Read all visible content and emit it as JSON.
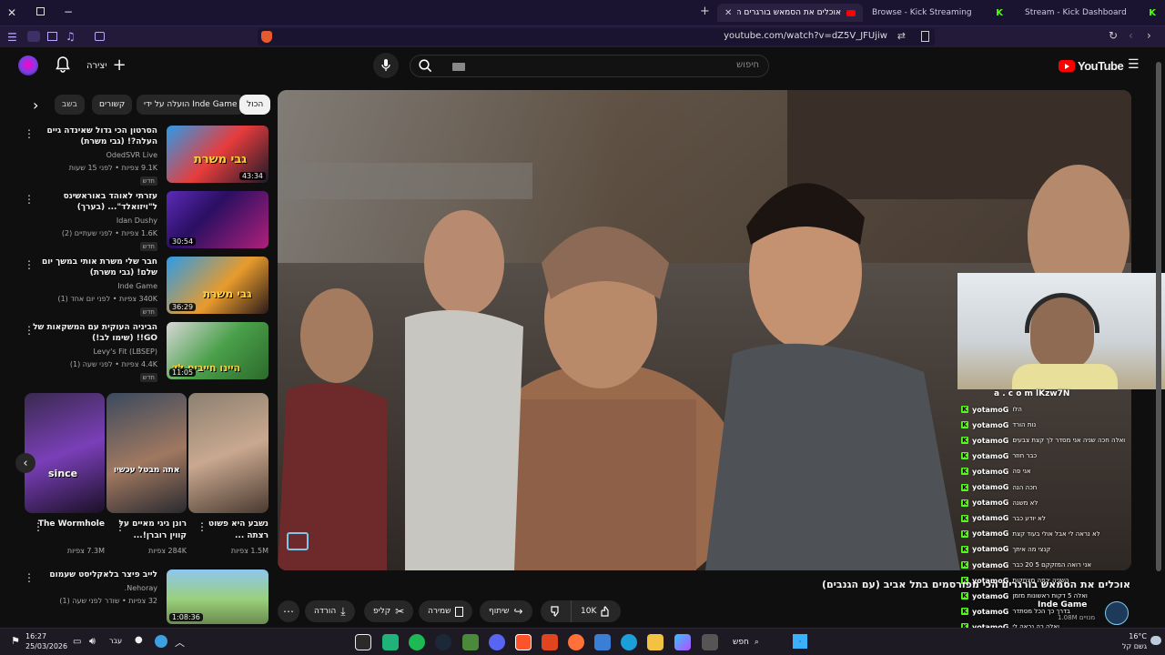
{
  "browser": {
    "tabs": [
      {
        "label": "אוכלים את הסמאש בורגרים ה",
        "active": true
      },
      {
        "label": "Browse - Kick Streaming",
        "active": false
      },
      {
        "label": "Stream - Kick Dashboard",
        "active": false
      }
    ],
    "address": "youtube.com/watch?v=dZ5V_JFUjiw"
  },
  "youtube": {
    "logo_text": "YouTube",
    "search_placeholder": "חיפוש",
    "create_label": "יצירה"
  },
  "chips": [
    "הכול",
    "הועלה על ידי Inde Game",
    "קשורים",
    "בשב"
  ],
  "recommended": [
    {
      "title": "הסרטון הכי גדול שאינדה גיים העלה?! (גבי משרת)",
      "channel": "OdedSVR Live",
      "meta": "9.1K צפיות • לפני 15 שעות",
      "duration": "43:34",
      "badge": "חדש",
      "thumb_text": "גבי משרת"
    },
    {
      "title": "עזרתי לאוהד באוראשינס ל\"ויזואלד\"... (בערך)",
      "channel": "Idan Dushy",
      "meta": "1.6K צפיות • לפני שעתיים (2)",
      "duration": "30:54",
      "badge": "חדש",
      "thumb_text": ""
    },
    {
      "title": "חבר שלי משרת אותי במשך יום שלם! (גבי משרת)",
      "channel": "Inde Game",
      "meta": "340K צפיות • לפני יום אחד (1)",
      "duration": "36:29",
      "badge": "חדש",
      "thumb_text": "גבי משרת"
    },
    {
      "title": "הביניה העוקית עם המשקאות של GO!! (שימו לב!)",
      "channel": "Levy's Fit (LBSEP)",
      "meta": "4.4K צפיות • לפני שעה (1)",
      "duration": "11:05",
      "badge": "חדש",
      "thumb_text": "היינו חייבים לד"
    }
  ],
  "shorts": [
    {
      "title": "The Wormhole",
      "views": "7.3M צפיות",
      "thumb_text": "since"
    },
    {
      "title": "רונן גיגי מאיים על קווין רוברן!...",
      "views": "284K צפיות",
      "thumb_text": "אתה מבטל עכשיו"
    },
    {
      "title": "נשבע היא פשוט רצתה ...",
      "views": "1.5M צפיות",
      "thumb_text": ""
    }
  ],
  "bottom_video": {
    "title": "לייב פיצר בלאקליסט שעמום",
    "channel": "Nehoray.",
    "meta": "32 צפיות • שודר לפני שעה (1)",
    "duration": "1:08:36"
  },
  "video": {
    "title": "אוכלים את הסמאש בורגרים הכי מפורסמים בתל אביב (עם הגנבים)",
    "likes": "10K",
    "share_label": "שיתוף",
    "save_label": "שמירה",
    "clip_label": "קליפ",
    "download_label": "הורדה"
  },
  "overlay": {
    "link_text": "a . c o m lKzw7N",
    "channel_badge": "Inde Game",
    "subs": "1.08M מנויים"
  },
  "chat": [
    {
      "user": "yotamoG",
      "text": "הלו"
    },
    {
      "user": "yotamoG",
      "text": "נות הורד"
    },
    {
      "user": "yotamoG",
      "text": "ואלה חכה שניה אני מסדר לך קצת צבעים"
    },
    {
      "user": "yotamoG",
      "text": "כבר חוזר"
    },
    {
      "user": "yotamoG",
      "text": "אני פה"
    },
    {
      "user": "yotamoG",
      "text": "חכה הנה"
    },
    {
      "user": "yotamoG",
      "text": "לא משנה"
    },
    {
      "user": "yotamoG",
      "text": "לא יודע כבר"
    },
    {
      "user": "yotamoG",
      "text": "לא נראה לי אבל אולי בעוד קצת"
    },
    {
      "user": "yotamoG",
      "text": "קנצי מה איתך"
    },
    {
      "user": "yotamoG",
      "text": "אני רואה המזקקם 5 20 כבר"
    },
    {
      "user": "yotamoG",
      "text": "השניה יכפה מצחקות"
    },
    {
      "user": "yotamoG",
      "text": "ואלה 5 דקות ראשונות מזמן"
    },
    {
      "user": "yotamoG",
      "text": "בדרך כך הכל מסתדר"
    },
    {
      "user": "yotamoG",
      "text": "ואלה כה נראה לי"
    },
    {
      "user": "yotamoG",
      "text": "שאתה יכול לעצור"
    }
  ],
  "taskbar": {
    "time": "16:27",
    "date": "25/03/2026",
    "lang": "עבר",
    "search_label": "חפש",
    "weather_temp": "16°C",
    "weather_desc": "גשם קל"
  }
}
